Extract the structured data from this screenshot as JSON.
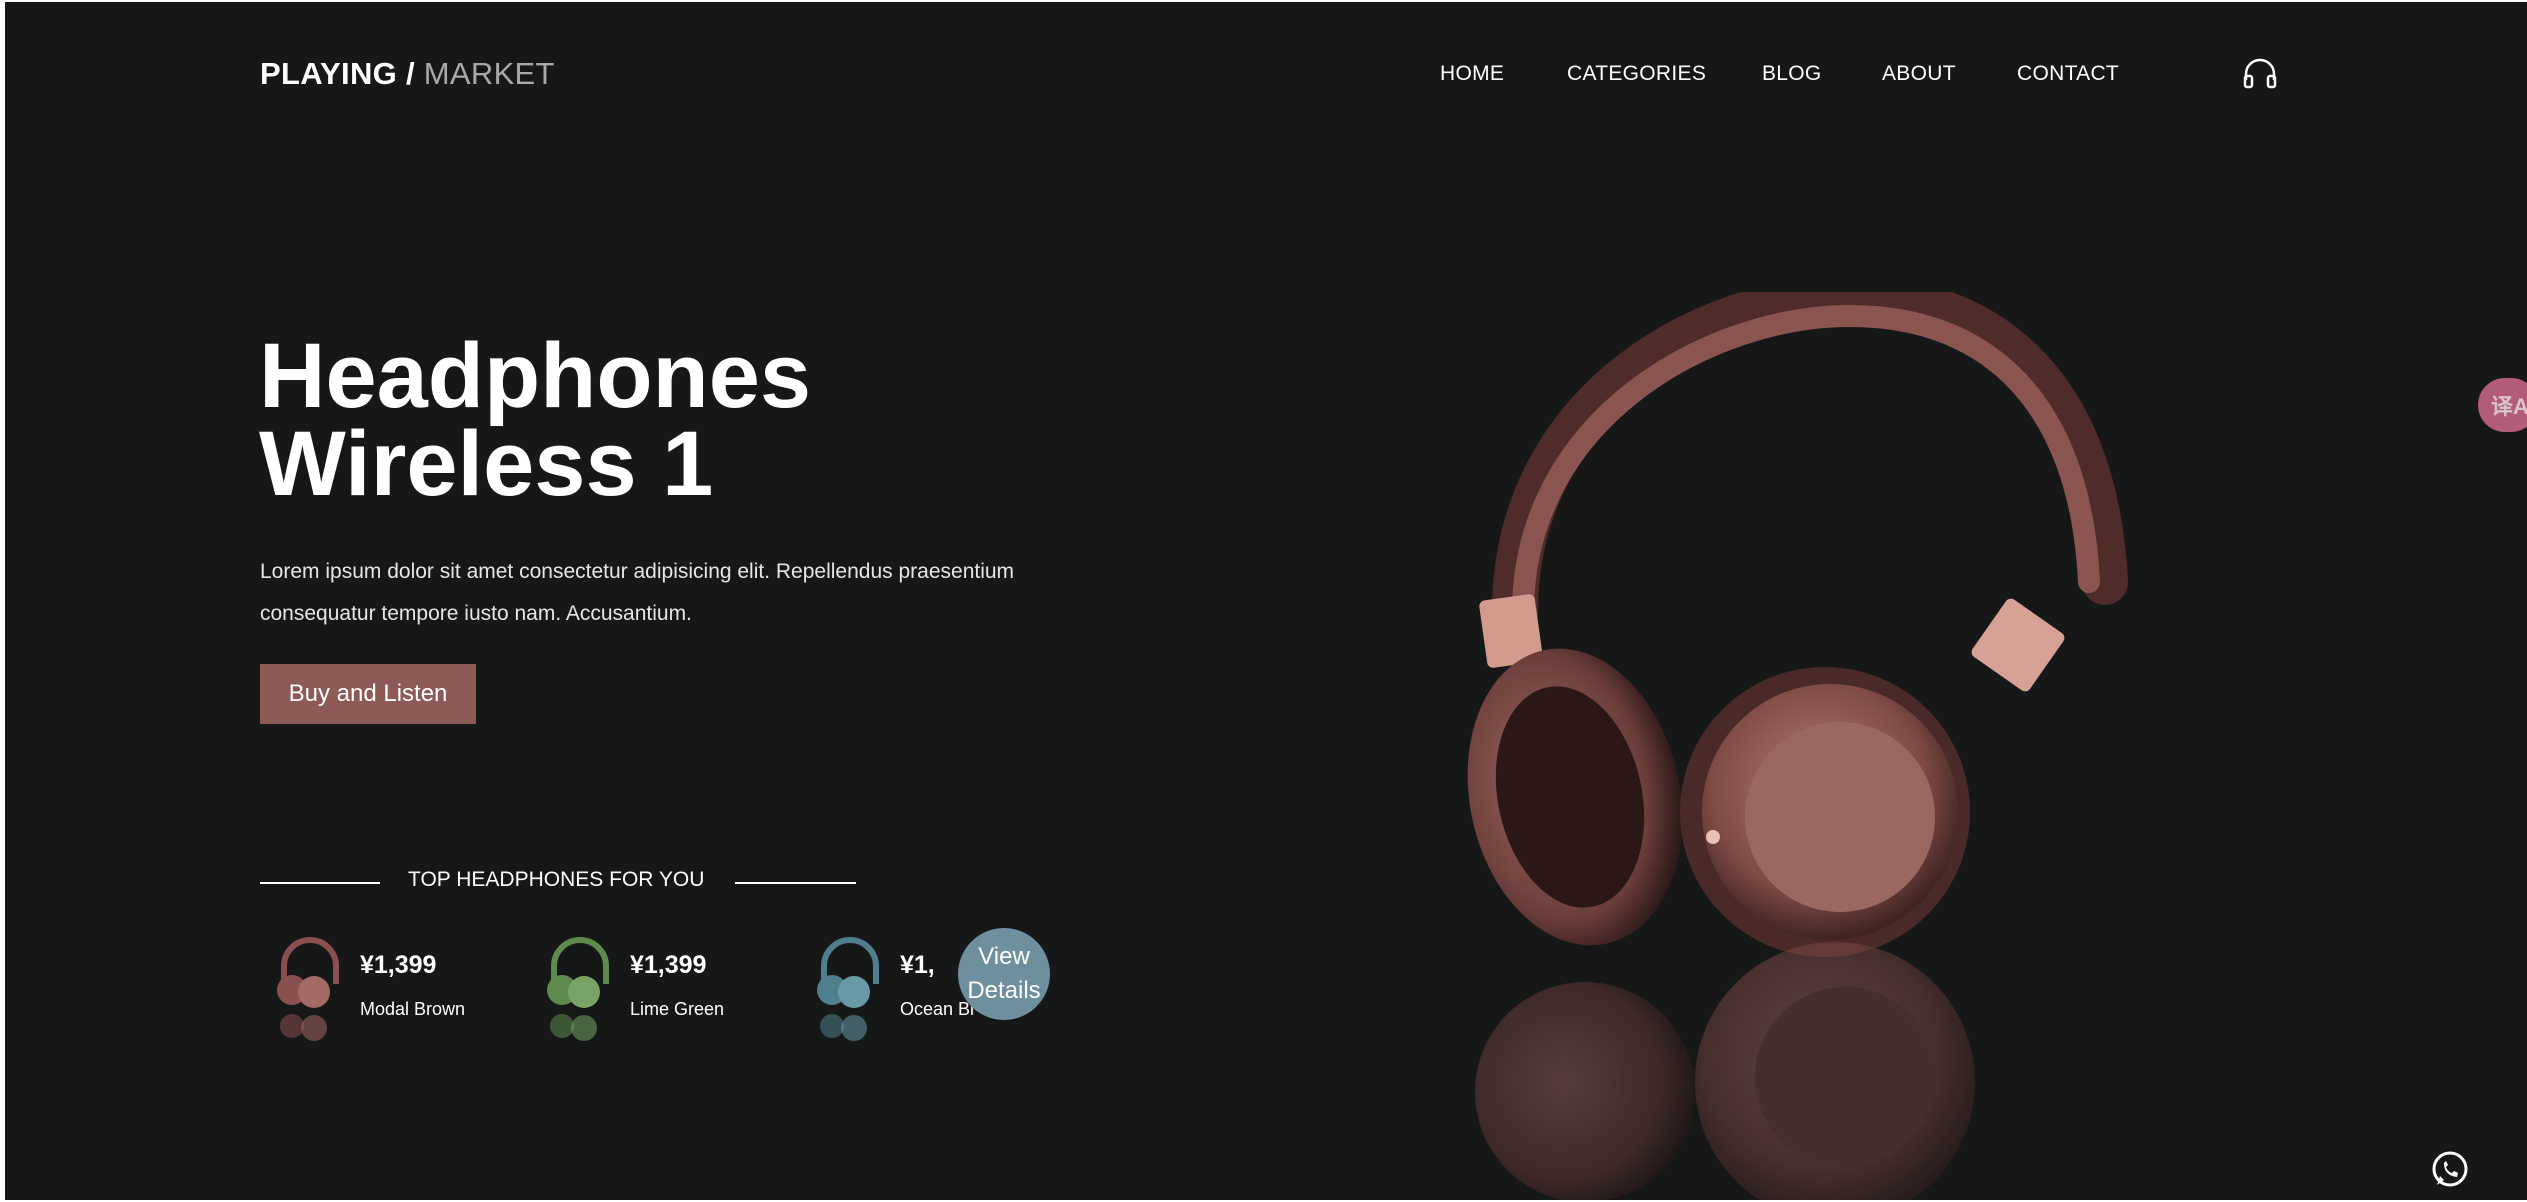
{
  "header": {
    "logo_primary": "PLAYING /",
    "logo_secondary": "MARKET",
    "nav": [
      "HOME",
      "CATEGORIES",
      "BLOG",
      "ABOUT",
      "CONTACT"
    ],
    "cart_icon": "headphones-icon"
  },
  "hero": {
    "title_line1": "Headphones",
    "title_line2": "Wireless 1",
    "description": "Lorem ipsum dolor sit amet consectetur adipisicing elit. Repellendus praesentium consequatur tempore iusto nam. Accusantium.",
    "cta_label": "Buy and Listen"
  },
  "top": {
    "title": "TOP HEADPHONES FOR YOU",
    "products": [
      {
        "price": "¥1,399",
        "name": "Modal Brown",
        "color": "#8a4f4f"
      },
      {
        "price": "¥1,399",
        "name": "Lime Green",
        "color": "#5f8a4e"
      },
      {
        "price": "¥1,",
        "name": "Ocean Bl",
        "color": "#4f7f8c"
      }
    ],
    "view_details_line1": "View",
    "view_details_line2": "Details"
  },
  "floating": {
    "translate_icon": "translate-icon",
    "translate_text": "译A",
    "whatsapp_icon": "whatsapp-icon"
  },
  "colors": {
    "background": "#161818",
    "accent": "#8e5a57",
    "view_details": "#6e8f9e",
    "translate": "#b25b7a"
  }
}
